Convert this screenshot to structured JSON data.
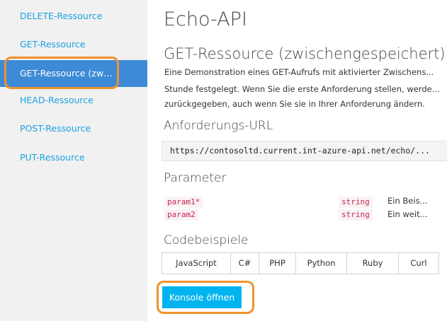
{
  "sidebar": {
    "items": [
      {
        "label": "DELETE-Ressource"
      },
      {
        "label": "GET-Ressource"
      },
      {
        "label": "GET-Ressource (zwisc..."
      },
      {
        "label": "HEAD-Ressource"
      },
      {
        "label": "POST-Ressource"
      },
      {
        "label": "PUT-Ressource"
      }
    ],
    "active_index": 2
  },
  "main": {
    "api_title": "Echo-API",
    "operation_title": "GET-Ressource (zwischengespeichert)",
    "description_lines": [
      "Eine Demonstration eines GET-Aufrufs mit aktivierter Zwischens...",
      "Stunde festgelegt. Wenn Sie die erste Anforderung stellen, werde...",
      "zurückgegeben, auch wenn Sie sie in Ihrer Anforderung ändern."
    ],
    "request_url_heading": "Anforderungs-URL",
    "request_url": "https://contosoltd.current.int-azure-api.net/echo/...",
    "parameters_heading": "Parameter",
    "parameters": [
      {
        "name": "param1*",
        "type": "string",
        "description": "Ein Beis..."
      },
      {
        "name": "param2",
        "type": "string",
        "description": "Ein weit..."
      }
    ],
    "code_samples_heading": "Codebeispiele",
    "code_tabs": [
      "JavaScript",
      "C#",
      "PHP",
      "Python",
      "Ruby",
      "Curl"
    ],
    "console_button_label": "Konsole öffnen"
  },
  "colors": {
    "link": "#1ba1e2",
    "active_nav_bg": "#3d8bd6",
    "highlight": "#f0922b",
    "button_bg": "#00b4f0",
    "code_text": "#c7254e"
  }
}
